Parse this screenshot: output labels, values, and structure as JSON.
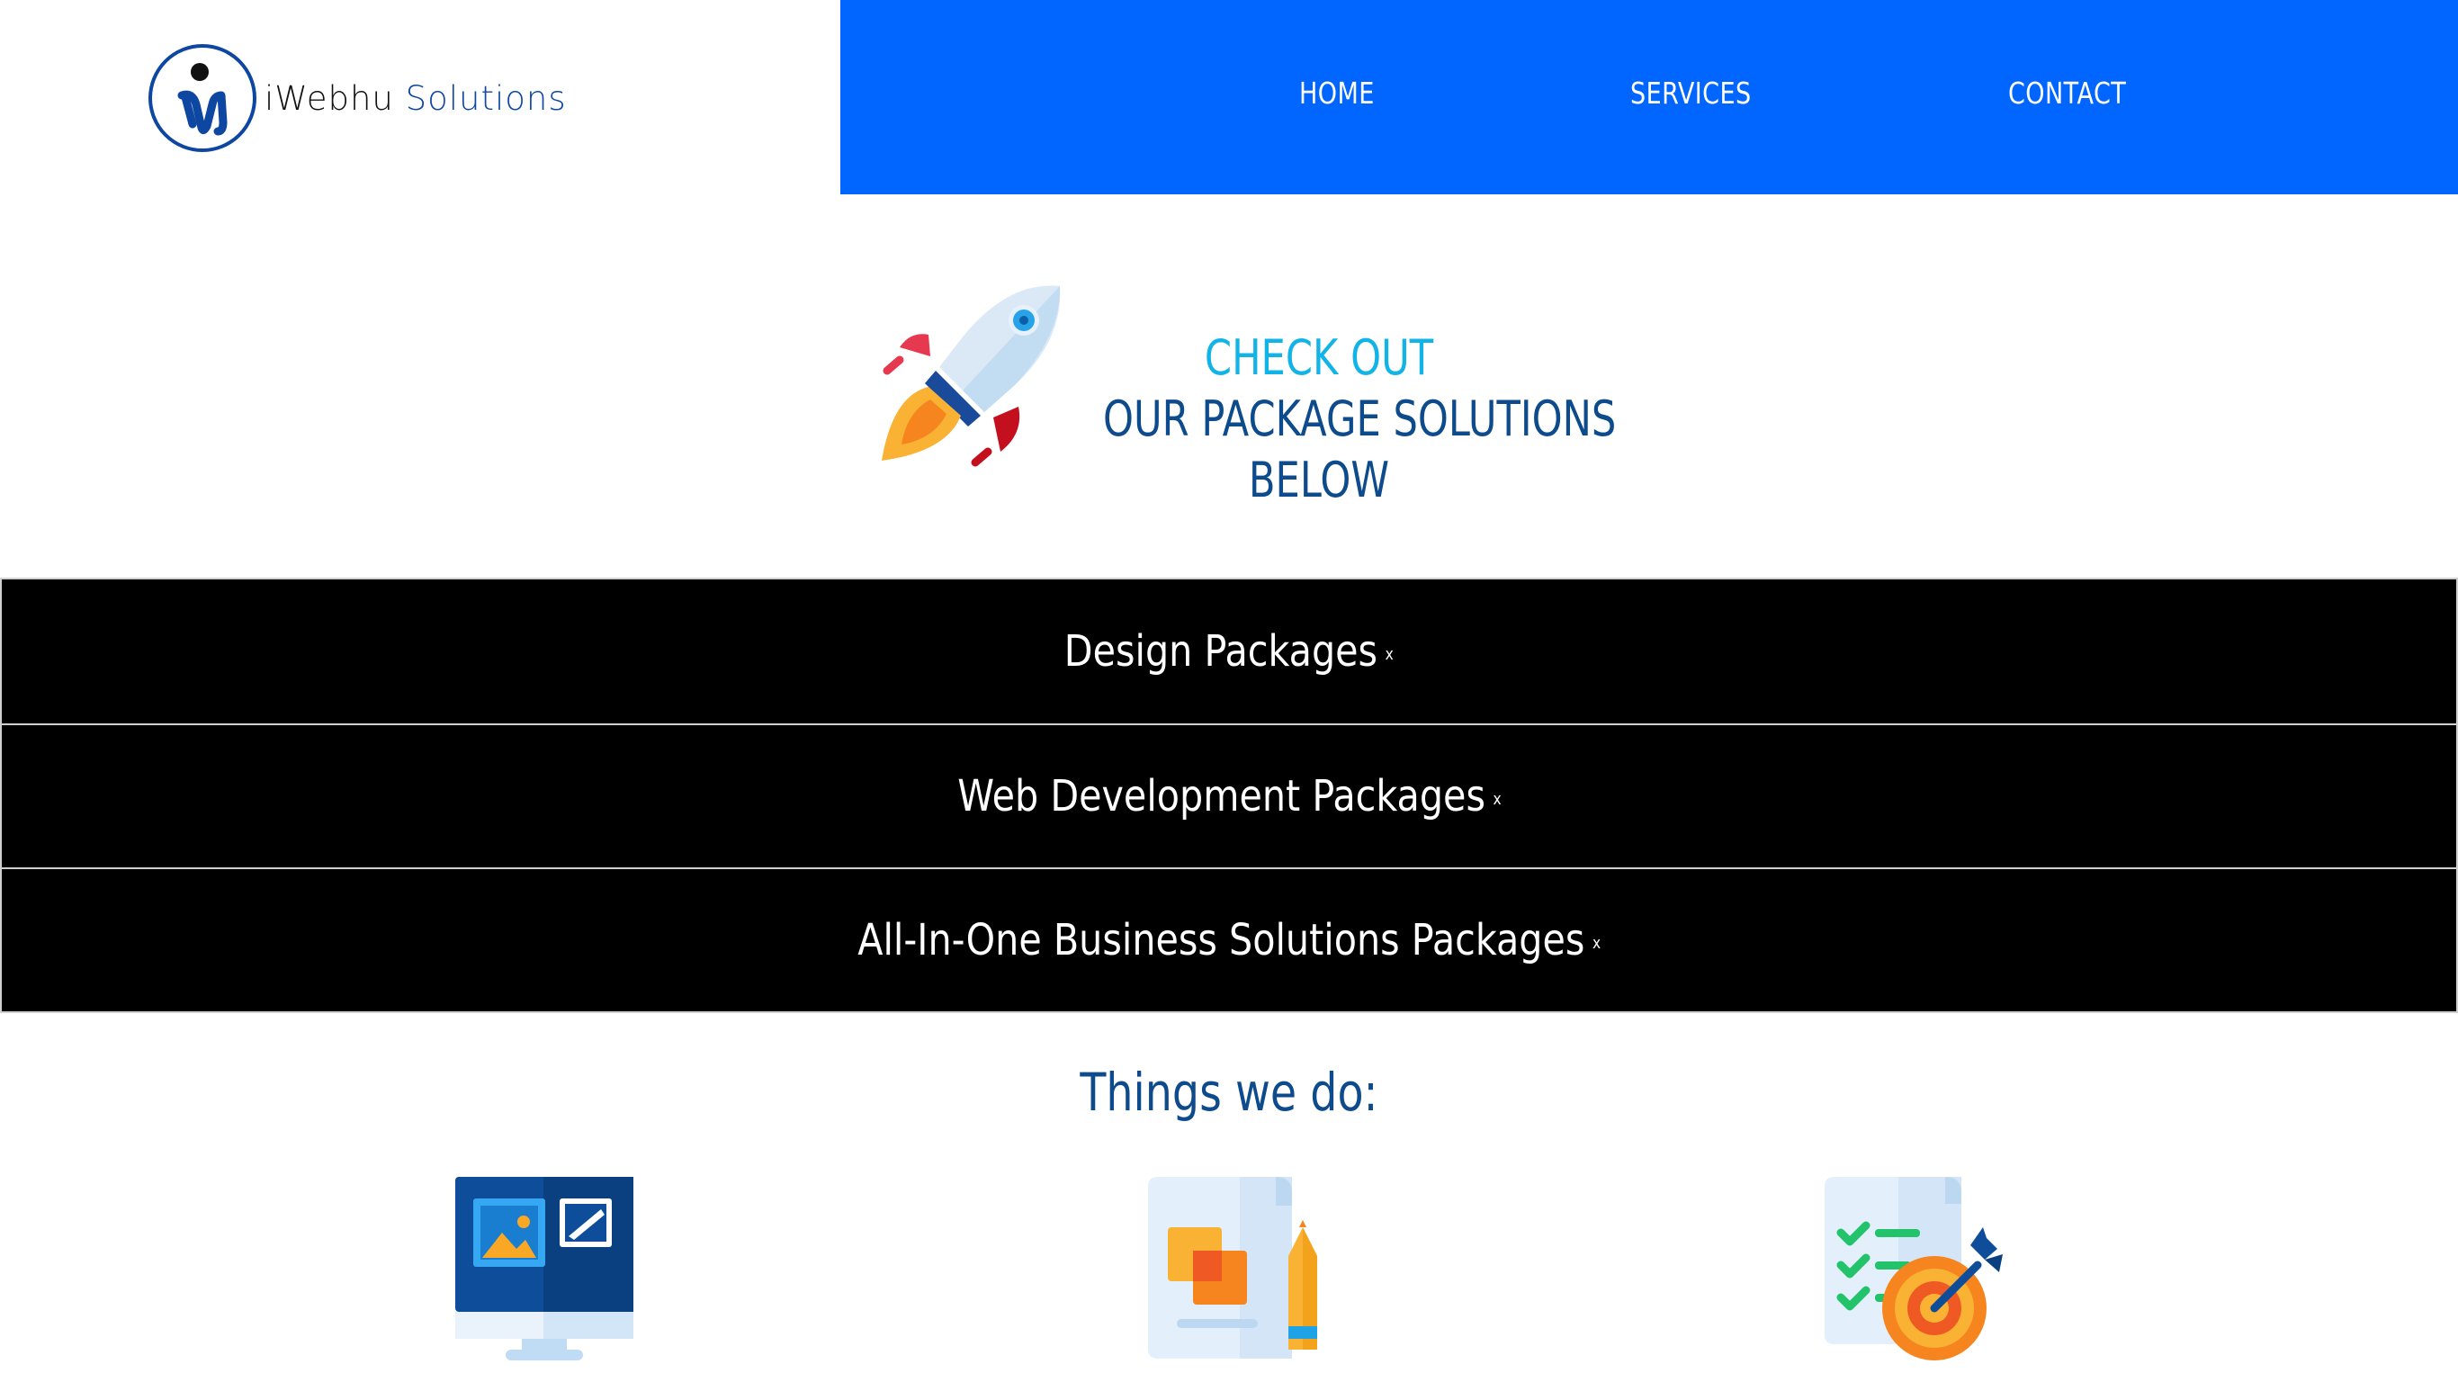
{
  "header": {
    "logo": {
      "text_i": "iWebhu",
      "text_s": "Solutions"
    },
    "nav": [
      "HOME",
      "SERVICES",
      "CONTACT"
    ]
  },
  "hero": {
    "line1": "CHECK OUT",
    "line2": "OUR PACKAGE SOLUTIONS",
    "line3": "BELOW"
  },
  "packages": [
    {
      "label": "Design Packages",
      "toggle": "x"
    },
    {
      "label": "Web Development Packages",
      "toggle": "x"
    },
    {
      "label": "All-In-One Business Solutions Packages",
      "toggle": "x"
    }
  ],
  "things": {
    "title": "Things we do:",
    "icons": [
      "monitor-design-icon",
      "graphic-design-icon",
      "seo-target-icon"
    ]
  },
  "colors": {
    "nav_bg": "#0066ff",
    "accent_cyan": "#12b3e6",
    "navy": "#0d4b8c",
    "package_bg": "#000000"
  }
}
